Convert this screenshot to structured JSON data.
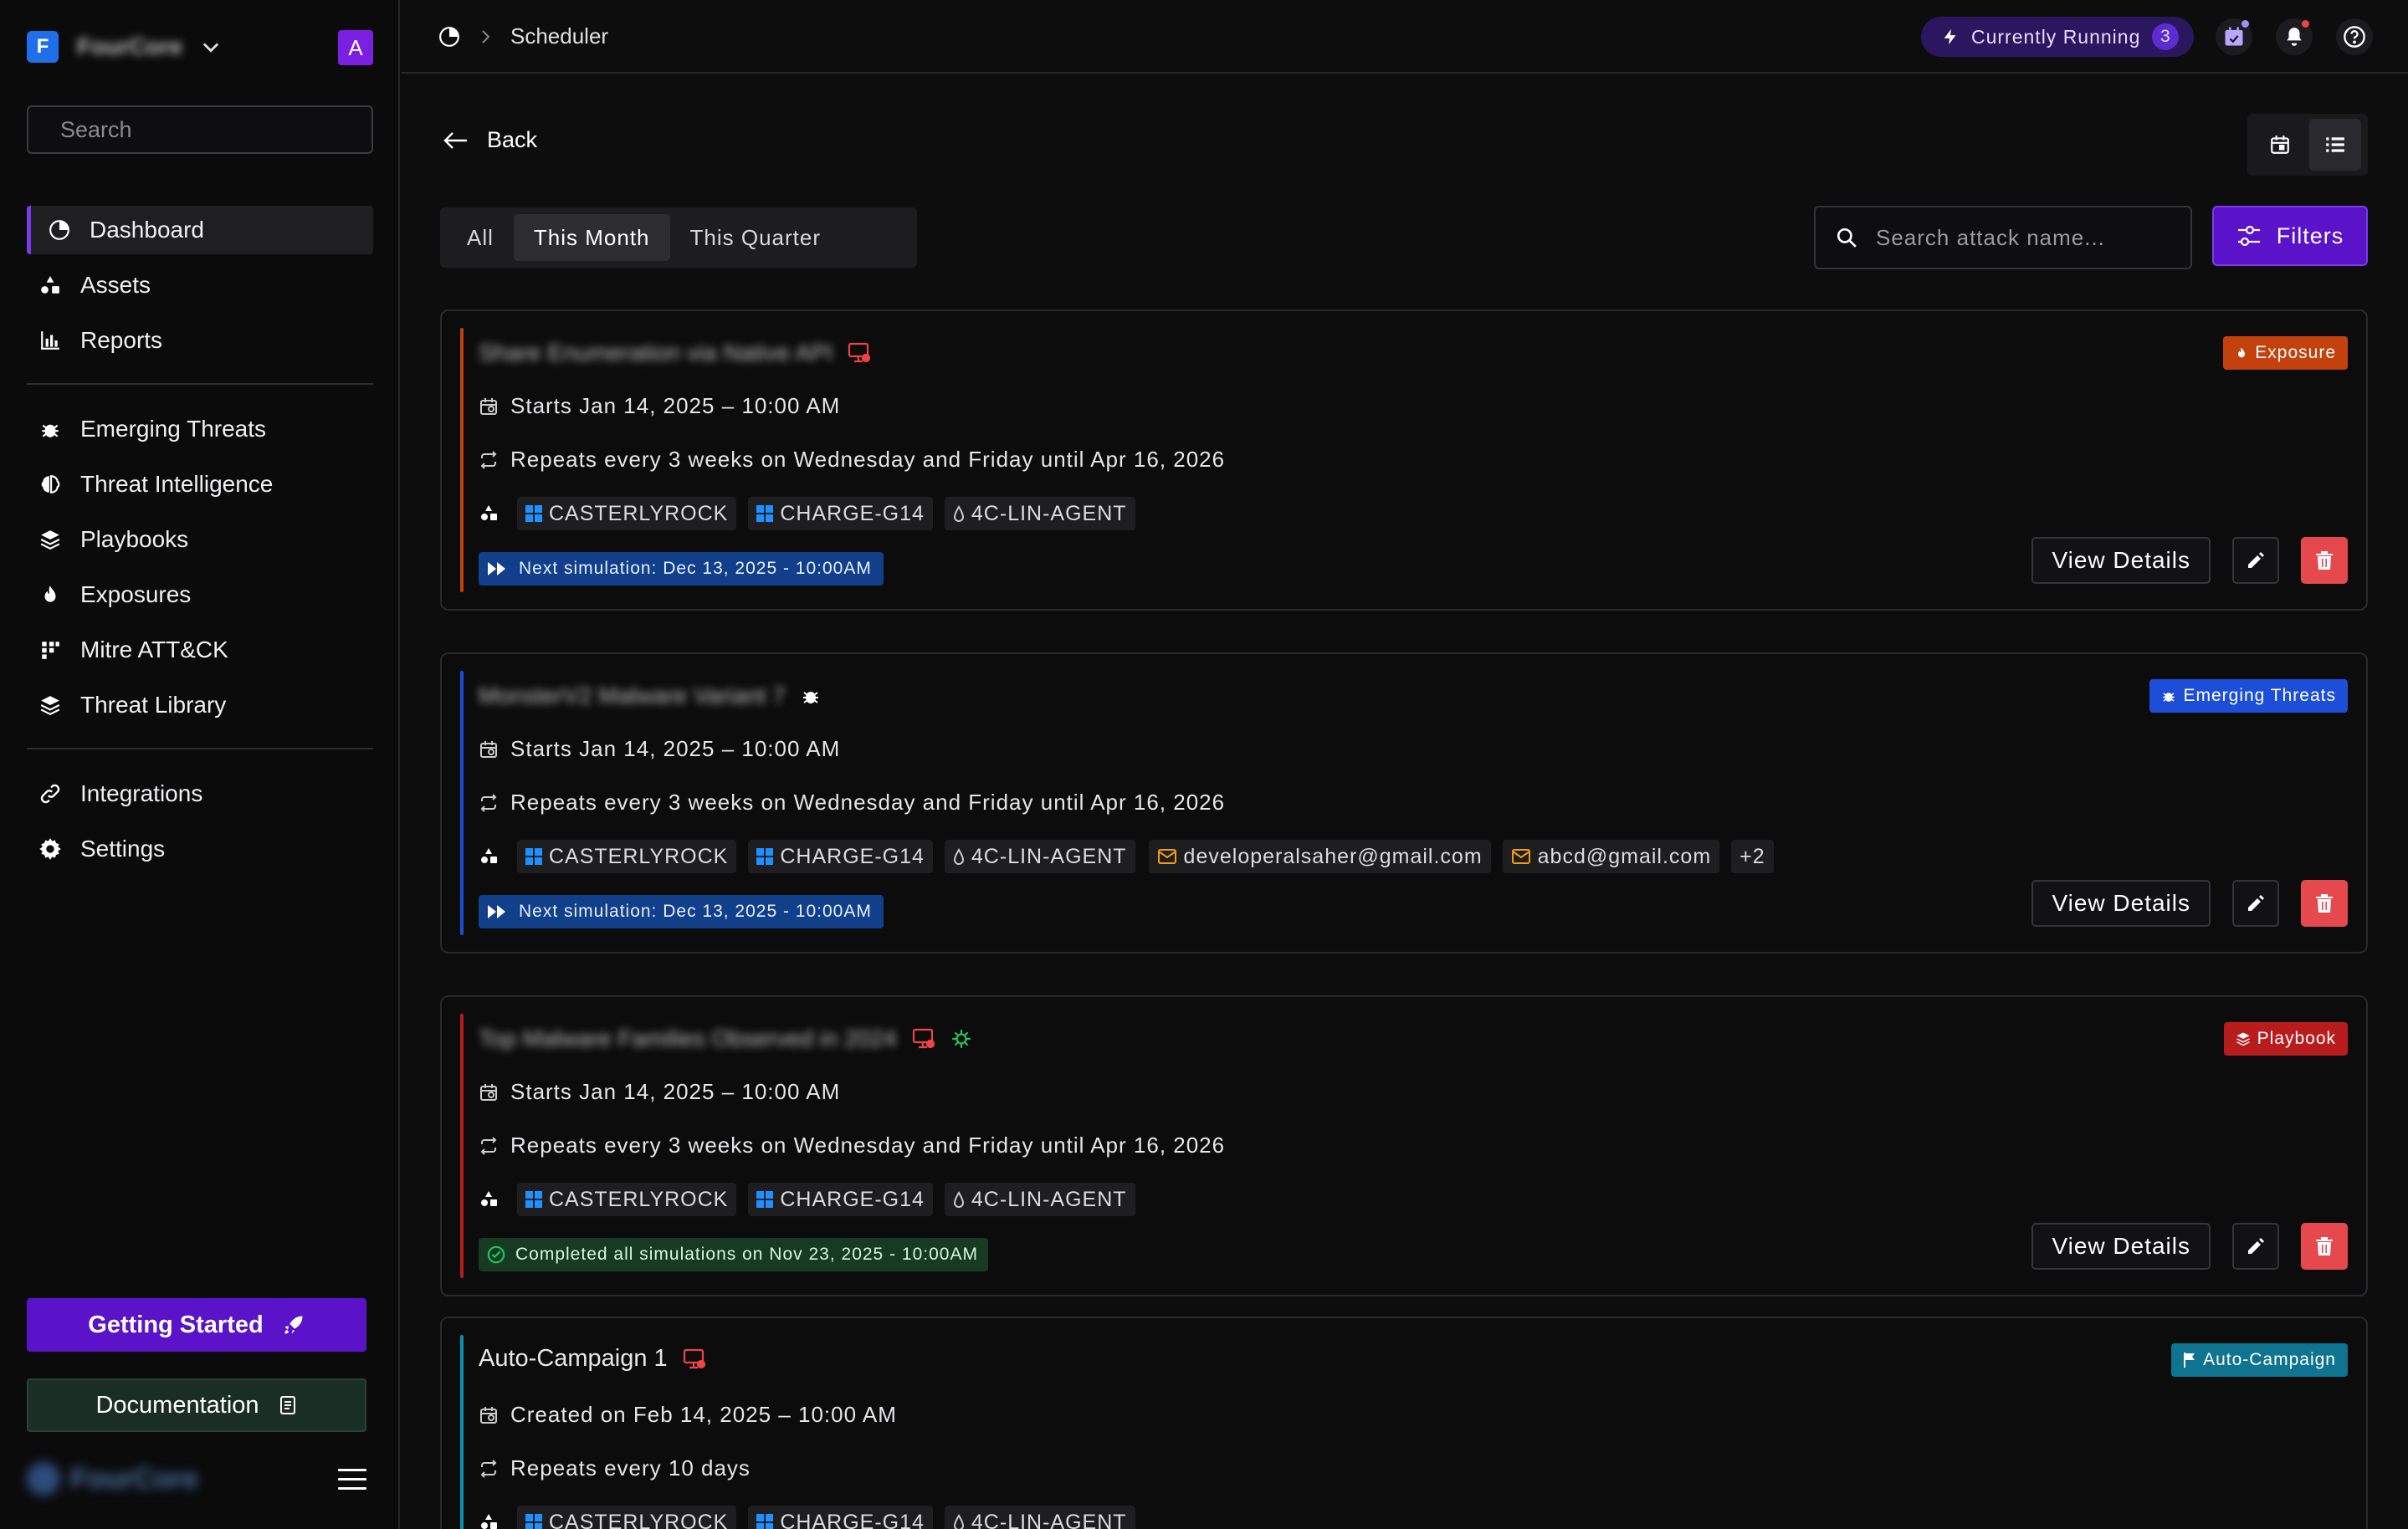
{
  "sidebar": {
    "brand_initial": "F",
    "brand_name": "FourCore",
    "avatar_initial": "A",
    "search_placeholder": "Search",
    "nav_primary": [
      {
        "label": "Dashboard",
        "icon": "dashboard-icon",
        "active": true
      },
      {
        "label": "Assets",
        "icon": "assets-icon"
      },
      {
        "label": "Reports",
        "icon": "reports-icon"
      }
    ],
    "nav_threats": [
      {
        "label": "Emerging Threats",
        "icon": "bug-icon"
      },
      {
        "label": "Threat Intelligence",
        "icon": "brain-icon"
      },
      {
        "label": "Playbooks",
        "icon": "layers-icon"
      },
      {
        "label": "Exposures",
        "icon": "flame-icon"
      },
      {
        "label": "Mitre ATT&CK",
        "icon": "grid-icon"
      },
      {
        "label": "Threat Library",
        "icon": "layers-icon"
      }
    ],
    "nav_settings": [
      {
        "label": "Integrations",
        "icon": "link-icon"
      },
      {
        "label": "Settings",
        "icon": "gear-icon"
      }
    ],
    "getting_started": "Getting Started",
    "documentation": "Documentation",
    "footer_brand": "FourCore"
  },
  "topbar": {
    "breadcrumb": "Scheduler",
    "running_label": "Currently Running",
    "running_count": "3"
  },
  "main": {
    "back_label": "Back",
    "segments": [
      "All",
      "This Month",
      "This Quarter"
    ],
    "selected_segment": "This Month",
    "search_placeholder": "Search attack name...",
    "filters_label": "Filters",
    "view_details_label": "View Details"
  },
  "cards": [
    {
      "title": "Share Enumeration via Native API",
      "starts": "Starts Jan 14, 2025 – 10:00 AM",
      "repeats": "Repeats every 3 weeks on Wednesday and Friday until Apr 16, 2026",
      "chips": [
        "CASTERLYROCK",
        "CHARGE-G14",
        "4C-LIN-AGENT"
      ],
      "status": "Next simulation: Dec 13, 2025 - 10:00AM",
      "tag": "Exposure",
      "tag_color": "#c2410c",
      "rail_color": "#c2410c"
    },
    {
      "title": "MonsterV2 Malware Variant 7",
      "starts": "Starts Jan 14, 2025 – 10:00 AM",
      "repeats": "Repeats every 3 weeks on Wednesday and Friday until Apr 16, 2026",
      "chips": [
        "CASTERLYROCK",
        "CHARGE-G14",
        "4C-LIN-AGENT"
      ],
      "emails": [
        "developeralsaher@gmail.com",
        "abcd@gmail.com"
      ],
      "more": "+2",
      "status": "Next simulation: Dec 13, 2025 - 10:00AM",
      "tag": "Emerging Threats",
      "tag_color": "#1d4ed8",
      "rail_color": "#1d4ed8"
    },
    {
      "title": "Top Malware Families Observed in 2024",
      "starts": "Starts Jan 14, 2025 – 10:00 AM",
      "repeats": "Repeats every 3 weeks on Wednesday and Friday until Apr 16, 2026",
      "chips": [
        "CASTERLYROCK",
        "CHARGE-G14",
        "4C-LIN-AGENT"
      ],
      "status": "Completed all simulations on Nov 23, 2025 - 10:00AM",
      "tag": "Playbook",
      "tag_color": "#b91c1c",
      "rail_color": "#b91c1c"
    },
    {
      "title": "Auto-Campaign 1",
      "starts": "Created on Feb 14, 2025 – 10:00 AM",
      "repeats": "Repeats every 10 days",
      "chips": [
        "CASTERLYROCK",
        "CHARGE-G14",
        "4C-LIN-AGENT"
      ],
      "tag": "Auto-Campaign",
      "tag_color": "#0e7490",
      "rail_color": "#0891b2"
    }
  ]
}
